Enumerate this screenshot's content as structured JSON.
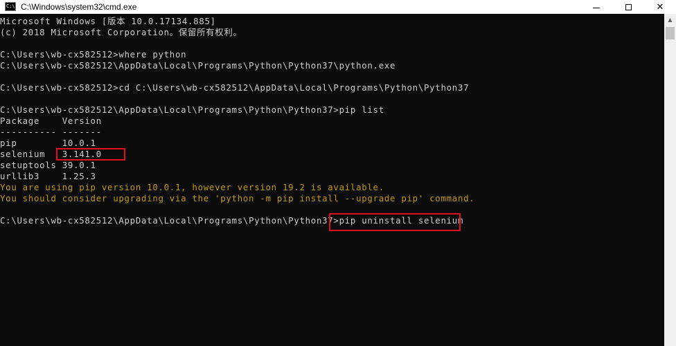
{
  "window": {
    "title": "C:\\Windows\\system32\\cmd.exe",
    "icon_label": "C:\\",
    "controls": {
      "minimize": "minimize-icon",
      "maximize": "maximize-icon",
      "close": "✕"
    }
  },
  "console": {
    "lines": [
      "Microsoft Windows [版本 10.0.17134.885]",
      "(c) 2018 Microsoft Corporation。保留所有权利。",
      "",
      "C:\\Users\\wb-cx582512>where python",
      "C:\\Users\\wb-cx582512\\AppData\\Local\\Programs\\Python\\Python37\\python.exe",
      "",
      "C:\\Users\\wb-cx582512>cd C:\\Users\\wb-cx582512\\AppData\\Local\\Programs\\Python\\Python37",
      "",
      "C:\\Users\\wb-cx582512\\AppData\\Local\\Programs\\Python\\Python37>pip list",
      "Package    Version",
      "---------- -------",
      "pip        10.0.1",
      "selenium   3.141.0",
      "setuptools 39.0.1",
      "urllib3    1.25.3",
      "You are using pip version 10.0.1, however version 19.2 is available.",
      "You should consider upgrading via the 'python -m pip install --upgrade pip' command.",
      "",
      "C:\\Users\\wb-cx582512\\AppData\\Local\\Programs\\Python\\Python37>pip uninstall selenium"
    ],
    "text_color": "#cccccc",
    "warning_color": "#c19c00",
    "background": "#0c0c0c",
    "highlight_color": "#e0101e"
  }
}
